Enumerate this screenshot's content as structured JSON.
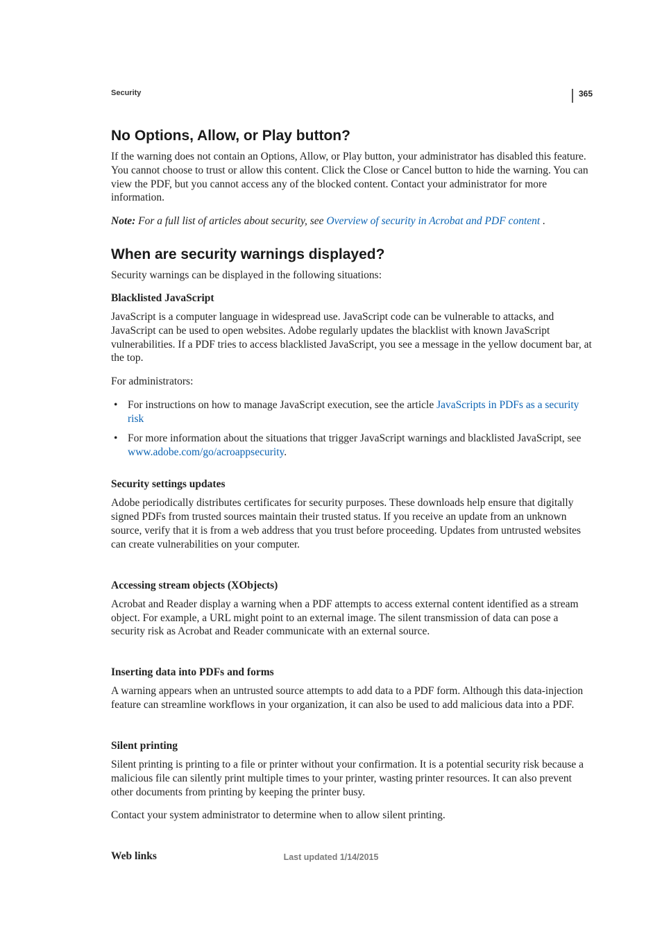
{
  "page_number": "365",
  "header_label": "Security",
  "h1": "No Options, Allow, or Play button?",
  "p1": "If the warning does not contain an Options, Allow, or Play button, your administrator has disabled this feature. You cannot choose to trust or allow this content. Click the Close or Cancel button to hide the warning. You can view the PDF, but you cannot access any of the blocked content. Contact your administrator for more information.",
  "note": {
    "label": "Note: ",
    "pre": "For a full list of articles about security, see ",
    "link": "Overview of security in Acrobat and PDF content",
    "post": " ."
  },
  "h2": "When are security warnings displayed?",
  "p2": "Security warnings can be displayed in the following situations:",
  "blacklisted": {
    "title": "Blacklisted JavaScript",
    "body": "JavaScript is a computer language in widespread use. JavaScript code can be vulnerable to attacks, and JavaScript can be used to open websites. Adobe regularly updates the blacklist with known JavaScript vulnerabilities. If a PDF tries to access blacklisted JavaScript, you see a message in the yellow document bar, at the top.",
    "admins_intro": "For administrators:",
    "bullet1_pre": "For instructions on how to manage JavaScript execution, see the article ",
    "bullet1_link": "JavaScripts in PDFs as a security risk",
    "bullet2_pre": "For more information about the situations that trigger JavaScript warnings and blacklisted JavaScript, see ",
    "bullet2_link": "www.adobe.com/go/acroappsecurity",
    "bullet2_post": "."
  },
  "security_updates": {
    "title": "Security settings updates",
    "body": "Adobe periodically distributes certificates for security purposes. These downloads help ensure that digitally signed PDFs from trusted sources maintain their trusted status. If you receive an update from an unknown source, verify that it is from a web address that you trust before proceeding. Updates from untrusted websites can create vulnerabilities on your computer."
  },
  "xobjects": {
    "title": "Accessing stream objects (XObjects)",
    "body": "Acrobat and Reader display a warning when a PDF attempts to access external content identified as a stream object. For example, a URL might point to an external image. The silent transmission of data can pose a security risk as Acrobat and Reader communicate with an external source."
  },
  "inserting": {
    "title": "Inserting data into PDFs and forms",
    "body": "A warning appears when an untrusted source attempts to add data to a PDF form. Although this data-injection feature can streamline workflows in your organization, it can also be used to add malicious data into a PDF."
  },
  "silent": {
    "title": "Silent printing",
    "body1": "Silent printing is printing to a file or printer without your confirmation. It is a potential security risk because a malicious file can silently print multiple times to your printer, wasting printer resources. It can also prevent other documents from printing by keeping the printer busy.",
    "body2": "Contact your system administrator to determine when to allow silent printing."
  },
  "weblinks_title": "Web links",
  "footer": "Last updated 1/14/2015"
}
